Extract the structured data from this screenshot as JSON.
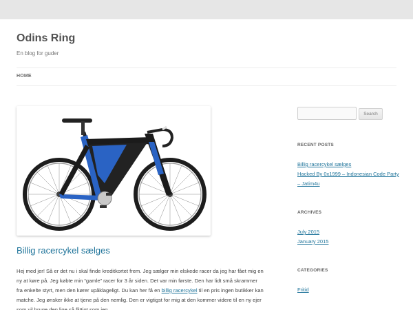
{
  "site": {
    "title": "Odins Ring",
    "tagline": "En blog for guder"
  },
  "nav": {
    "items": [
      {
        "label": "HOME"
      }
    ]
  },
  "post": {
    "image_alt": "road bicycle",
    "title": "Billig racercykel sælges",
    "body_part1": "Hej med jer! Så er det nu i skal finde kreditkortet frem. Jeg sælger min elskede racer da jeg har fået mig en ny at køre på. Jeg købte min “gamle” racer for 3 år siden. Det var min første. Den har lidt små skrammer fra enkelte styrt, men den kører upåklageligt. Du kan her få en ",
    "body_link": "billig racercykel",
    "body_part2": " til en pris ingen butikker kan matche. Jeg ønsker ikke at tjene på den nemlig. Den er vigtigst for mig at den kommer videre til en ny ejer som vil bruge den lige så flittigt som jeg."
  },
  "sidebar": {
    "search": {
      "placeholder": "",
      "button_label": "Search"
    },
    "recent_posts": {
      "title": "RECENT POSTS",
      "items": [
        "Billig racercykel sælges",
        "Hacked By 0x1999 – Indonesian Code Party – Jatim4u"
      ]
    },
    "archives": {
      "title": "ARCHIVES",
      "items": [
        "July 2015",
        "January 2015"
      ]
    },
    "categories": {
      "title": "CATEGORIES",
      "items": [
        "Fritid"
      ]
    }
  },
  "colors": {
    "link": "#21759b",
    "bike_blue": "#2a63c4",
    "bike_black": "#1b1b1b"
  }
}
